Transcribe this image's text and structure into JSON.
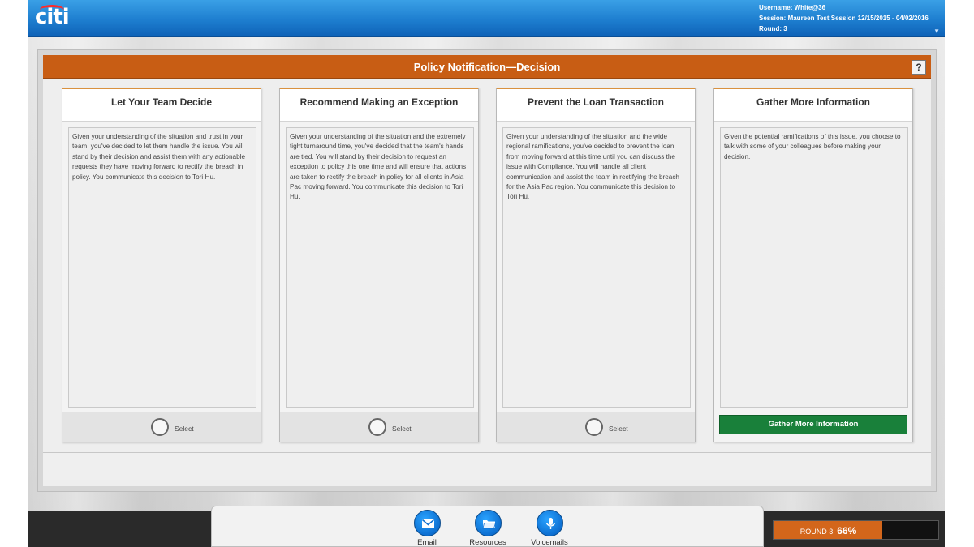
{
  "app": {
    "logo_text": "citi"
  },
  "user": {
    "username_line": "Username: White@36",
    "session_line": "Session: Maureen Test Session 12/15/2015 - 04/02/2016",
    "round_line": "Round: 3"
  },
  "panel": {
    "title": "Policy Notification—Decision",
    "help_label": "?"
  },
  "cards": [
    {
      "title": "Let Your Team Decide",
      "text": "Given your understanding of the situation and trust in your team, you've decided to let them handle the issue. You will stand by their decision and assist them with any actionable requests they have moving forward to rectify the breach in policy. You communicate this decision to Tori Hu.",
      "action_label": "Select"
    },
    {
      "title": "Recommend Making an Exception",
      "text": "Given your understanding of the situation and the extremely tight turnaround time, you've decided that the team's hands are tied. You will stand by their decision to request an exception to policy this one time and will ensure that actions are taken to rectify the breach in policy for all clients in Asia Pac moving forward. You communicate this decision to Tori Hu.",
      "action_label": "Select"
    },
    {
      "title": "Prevent the Loan Transaction",
      "text": "Given your understanding of the situation and the wide regional ramifications, you've decided to prevent the loan from moving forward at this time until you can discuss the issue with Compliance. You will handle all client communication and assist the team in rectifying the breach for the Asia Pac region. You communicate this decision to Tori Hu.",
      "action_label": "Select"
    },
    {
      "title": "Gather More Information",
      "text": "Given the potential ramifications of this issue, you choose to talk with some of your colleagues before making your decision.",
      "action_label": "Gather More Information"
    }
  ],
  "dock": {
    "items": [
      {
        "label": "Email",
        "icon": "email-icon"
      },
      {
        "label": "Resources",
        "icon": "folder-icon"
      },
      {
        "label": "Voicemails",
        "icon": "microphone-icon"
      }
    ]
  },
  "progress": {
    "round_label": "ROUND 3:",
    "percent_text": "66%",
    "fraction": 0.66
  },
  "colors": {
    "header_orange": "#c85d14",
    "card_accent": "#d9913f",
    "green_button": "#19803a",
    "topbar_blue": "#1e7fd0",
    "dock_icon_blue": "#0d6fd1"
  }
}
